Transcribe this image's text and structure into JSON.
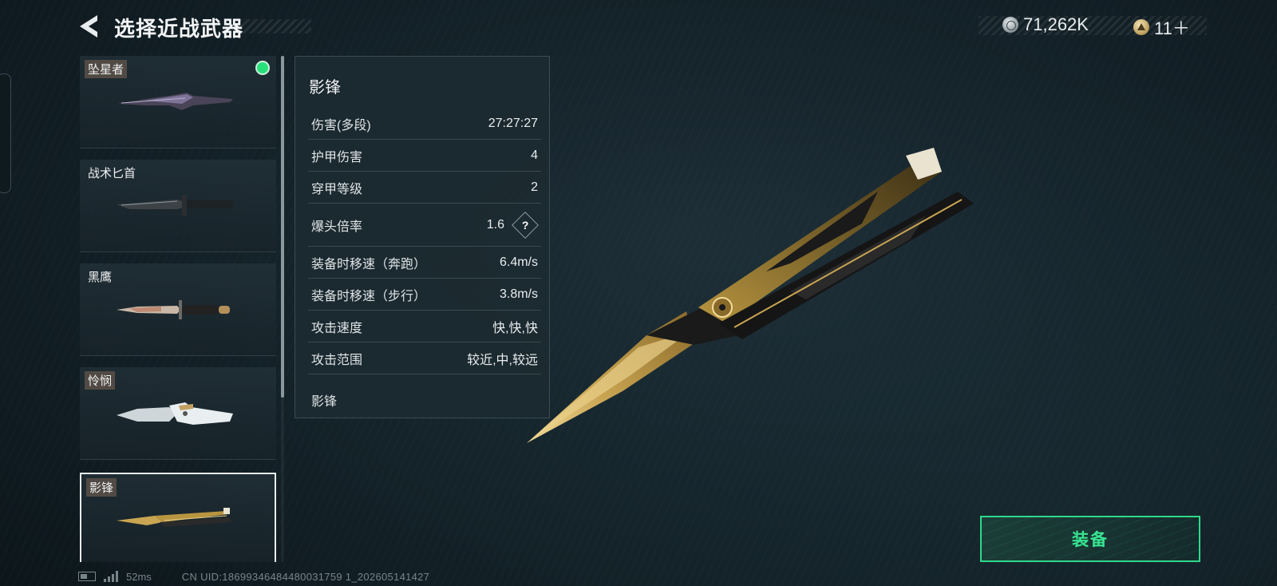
{
  "header": {
    "title": "选择近战武器",
    "back_icon": "back-arrow-icon"
  },
  "currency": {
    "silver": {
      "amount": "71,262K",
      "icon": "silver-coin-icon"
    },
    "gold": {
      "amount": "11＋",
      "icon": "gold-coin-icon"
    }
  },
  "weapons": [
    {
      "name": "坠星者",
      "equipped": true,
      "selected": false,
      "tag_style": true
    },
    {
      "name": "战术匕首",
      "equipped": false,
      "selected": false,
      "tag_style": false
    },
    {
      "name": "黑鹰",
      "equipped": false,
      "selected": false,
      "tag_style": false
    },
    {
      "name": "怜悯",
      "equipped": false,
      "selected": false,
      "tag_style": true
    },
    {
      "name": "影锋",
      "equipped": false,
      "selected": true,
      "tag_style": true
    }
  ],
  "stats": {
    "title": "影锋",
    "rows": [
      {
        "label": "伤害(多段)",
        "value": "27:27:27"
      },
      {
        "label": "护甲伤害",
        "value": "4"
      },
      {
        "label": "穿甲等级",
        "value": "2"
      },
      {
        "label": "爆头倍率",
        "value": "1.6",
        "help": "?"
      },
      {
        "label": "装备时移速（奔跑）",
        "value": "6.4m/s"
      },
      {
        "label": "装备时移速（步行）",
        "value": "3.8m/s"
      },
      {
        "label": "攻击速度",
        "value": "快,快,快"
      },
      {
        "label": "攻击范围",
        "value": "较近,中,较远"
      }
    ],
    "footer": "影锋"
  },
  "equip_button": {
    "label": "装备"
  },
  "status": {
    "ping": "52ms",
    "uid": "CN UID:18699346484480031759 1_202605141427"
  },
  "colors": {
    "accent_green": "#38e592",
    "equipped_dot": "#28e07a",
    "gold": "#c9a552"
  }
}
